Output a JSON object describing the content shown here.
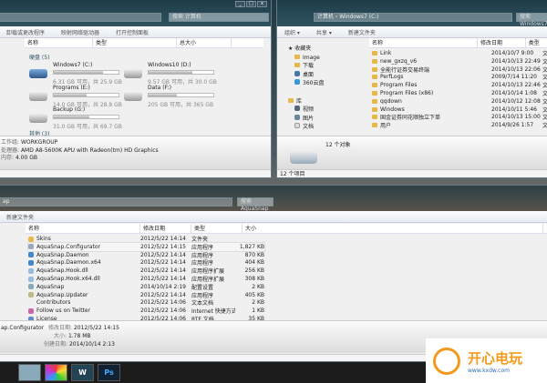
{
  "win1": {
    "search": "搜索 计算机",
    "toolbar": [
      "卸载或更改程序",
      "映射网络驱动器",
      "打开控制面板"
    ],
    "columns": [
      "名称",
      "类型",
      "总大小"
    ],
    "group_drives": "硬盘 (5)",
    "group_other": "其他 (3)",
    "drives": [
      {
        "name": "Windows7 (C:)",
        "space": "6.31 GB 可用，共 25.9 GB",
        "used": 0.76
      },
      {
        "name": "Windows10 (D:)",
        "space": "9.57 GB 可用，共 30.0 GB",
        "used": 0.68
      },
      {
        "name": "Programs (E:)",
        "space": "14.0 GB 可用，共 28.8 GB",
        "used": 0.51
      },
      {
        "name": "Data (F:)",
        "space": "205 GB 可用，共 365 GB",
        "used": 0.44
      },
      {
        "name": "Backup (G:)",
        "space": "31.0 GB 可用，共 69.7 GB",
        "used": 0.55
      }
    ],
    "details": [
      {
        "label": "工作组:",
        "value": "WORKGROUP"
      },
      {
        "label": "处理器:",
        "value": "AMD A8-5600K APU with Radeon(tm) HD Graphics"
      },
      {
        "label": "内存:",
        "value": "4.00 GB"
      }
    ]
  },
  "win2": {
    "breadcrumb": [
      "计算机",
      "Windows7 (C:)"
    ],
    "search": "搜索 Windows7 (C:)",
    "toolbar": [
      "组织 ▾",
      "共享 ▾",
      "新建文件夹"
    ],
    "sidebar": {
      "favorites": "收藏夹",
      "fav_items": [
        "Image",
        "下载",
        "桌面",
        "360云盘"
      ],
      "library": "库",
      "lib_items": [
        "视频",
        "图片",
        "文档"
      ]
    },
    "columns": [
      "名称",
      "修改日期",
      "类型"
    ],
    "rows": [
      [
        "Link",
        "2014/10/7 9:00",
        "文件夹"
      ],
      [
        "new_gxzq_v6",
        "2014/10/13 22:49",
        "文件夹"
      ],
      [
        "全能行证券交易终端",
        "2014/10/13 22:06",
        "文件夹"
      ],
      [
        "PerfLogs",
        "2009/7/14 11:20",
        "文件夹"
      ],
      [
        "Program Files",
        "2014/10/13 22:46",
        "文件夹"
      ],
      [
        "Program Files (x86)",
        "2014/10/14 1:08",
        "文件夹"
      ],
      [
        "qqdown",
        "2014/10/12 12:08",
        "文件夹"
      ],
      [
        "Windows",
        "2014/10/11 5:46",
        "文件夹"
      ],
      [
        "国金证券同花顺独立下单",
        "2014/10/13 15:00",
        "文件夹"
      ],
      [
        "用户",
        "2014/9/26 1:57",
        "文件夹"
      ]
    ],
    "count": "12 个对象",
    "status": "12 个项目"
  },
  "win3": {
    "address": "ap",
    "search": "搜索 AquaSnap",
    "toolbar": [
      "新建文件夹"
    ],
    "columns": [
      "名称",
      "修改日期",
      "类型",
      "大小"
    ],
    "rows": [
      [
        "Skins",
        "2012/5/22 14:14",
        "文件夹",
        ""
      ],
      [
        "AquaSnap.Configurator",
        "2012/5/22 14:15",
        "应用程序",
        "1,827 KB"
      ],
      [
        "AquaSnap.Daemon",
        "2012/5/22 14:14",
        "应用程序",
        "870 KB"
      ],
      [
        "AquaSnap.Daemon.x64",
        "2012/5/22 14:14",
        "应用程序",
        "404 KB"
      ],
      [
        "AquaSnap.Hook.dll",
        "2012/5/22 14:14",
        "应用程序扩展",
        "256 KB"
      ],
      [
        "AquaSnap.Hook.x64.dll",
        "2012/5/22 14:14",
        "应用程序扩展",
        "308 KB"
      ],
      [
        "AquaSnap",
        "2014/10/14 2:19",
        "配置设置",
        "2 KB"
      ],
      [
        "AquaSnap.Updater",
        "2012/5/22 14:14",
        "应用程序",
        "405 KB"
      ],
      [
        "Contributors",
        "2012/5/22 14:06",
        "文本文档",
        "2 KB"
      ],
      [
        "Follow us on Twitter",
        "2012/5/22 14:06",
        "Internet 快捷方式",
        "1 KB"
      ],
      [
        "License",
        "2012/5/22 14:06",
        "RTF 文档",
        "35 KB"
      ]
    ],
    "details": {
      "name": "ap.Configurator",
      "modified_label": "修改日期:",
      "modified": "2012/5/22 14:15",
      "size_label": "大小:",
      "size": "1.78 MB",
      "created_label": "创建日期:",
      "created": "2014/10/14 2:13"
    }
  },
  "taskbar": {
    "apps": [
      "explorer",
      "picasa",
      "W",
      "Ps"
    ]
  },
  "watermark": {
    "text": "开心电玩",
    "url": "www.kxdw.com"
  }
}
